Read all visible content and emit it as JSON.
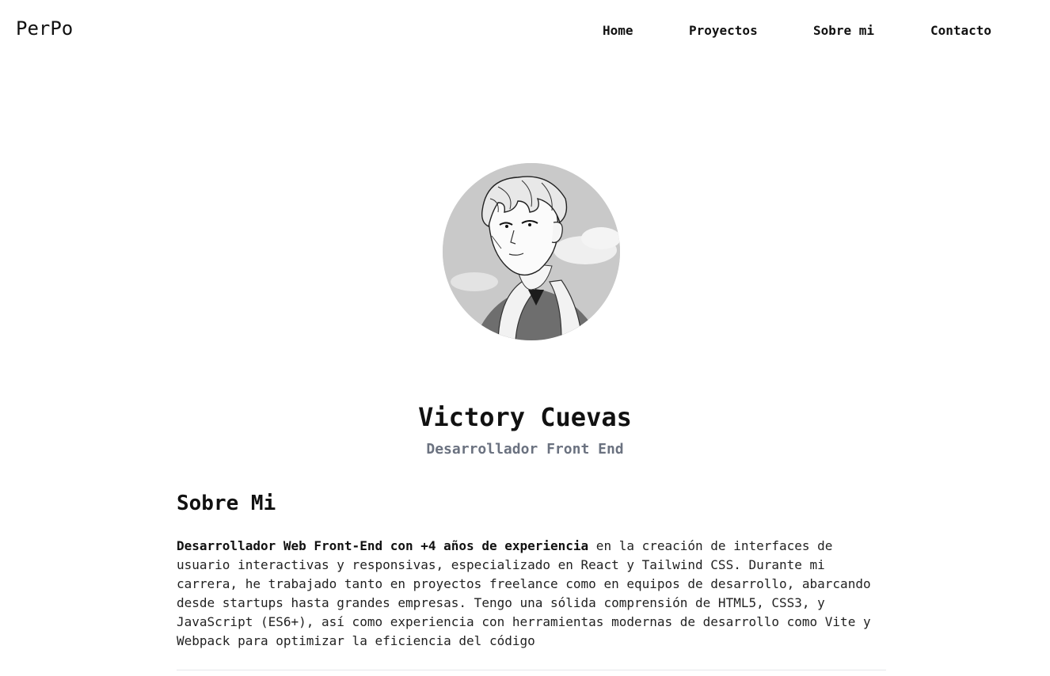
{
  "header": {
    "logo": "PerPo",
    "nav": [
      {
        "label": "Home"
      },
      {
        "label": "Proyectos"
      },
      {
        "label": "Sobre mi"
      },
      {
        "label": "Contacto"
      }
    ]
  },
  "profile": {
    "avatar_icon": "manga-portrait-avatar",
    "name": "Victory Cuevas",
    "role": "Desarrollador Front End"
  },
  "about": {
    "title": "Sobre Mi",
    "highlight": "Desarrollador Web Front-End con +4 años de experiencia",
    "body": " en la creación de interfaces de usuario interactivas y responsivas, especializado en React y Tailwind CSS. Durante mi carrera, he trabajado tanto en proyectos freelance como en equipos de desarrollo, abarcando desde startups hasta grandes empresas. Tengo una sólida comprensión de HTML5, CSS3, y JavaScript (ES6+), así como experiencia con herramientas modernas de desarrollo como Vite y Webpack para optimizar la eficiencia del código"
  },
  "colors": {
    "text": "#111111",
    "muted": "#6b7280",
    "divider": "#e5e7eb",
    "background": "#ffffff"
  }
}
